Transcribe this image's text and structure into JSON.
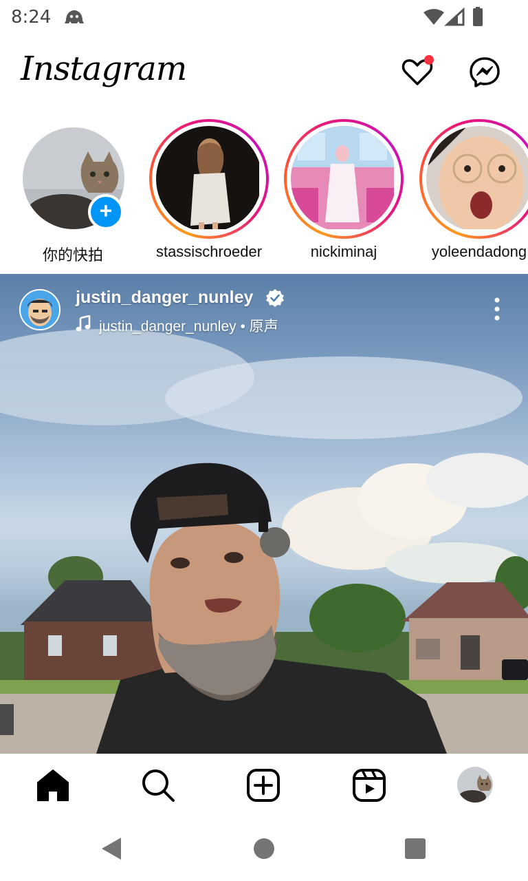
{
  "status_bar": {
    "time": "8:24",
    "icons": [
      "ghost-icon",
      "wifi-icon",
      "signal-icon",
      "battery-icon"
    ]
  },
  "header": {
    "logo": "Instagram",
    "notification_dot_color": "#ff3040",
    "icons": [
      "heart-icon",
      "messenger-icon"
    ]
  },
  "stories": [
    {
      "label": "你的快拍",
      "own": true
    },
    {
      "label": "stassischroeder"
    },
    {
      "label": "nickiminaj"
    },
    {
      "label": "yoleendadong"
    }
  ],
  "post": {
    "username": "justin_danger_nunley",
    "verified": true,
    "audio": "justin_danger_nunley • 原声",
    "verified_color": "#ffffff"
  },
  "bottom_nav": {
    "items": [
      "home-icon",
      "search-icon",
      "create-icon",
      "reels-icon",
      "profile-avatar"
    ]
  },
  "system_nav": {
    "items": [
      "back-icon",
      "home-circle-icon",
      "recents-icon"
    ]
  },
  "colors": {
    "story_ring_start": "#fd9a1f",
    "story_ring_end": "#c913b9",
    "add_story_blue": "#0095f6"
  }
}
